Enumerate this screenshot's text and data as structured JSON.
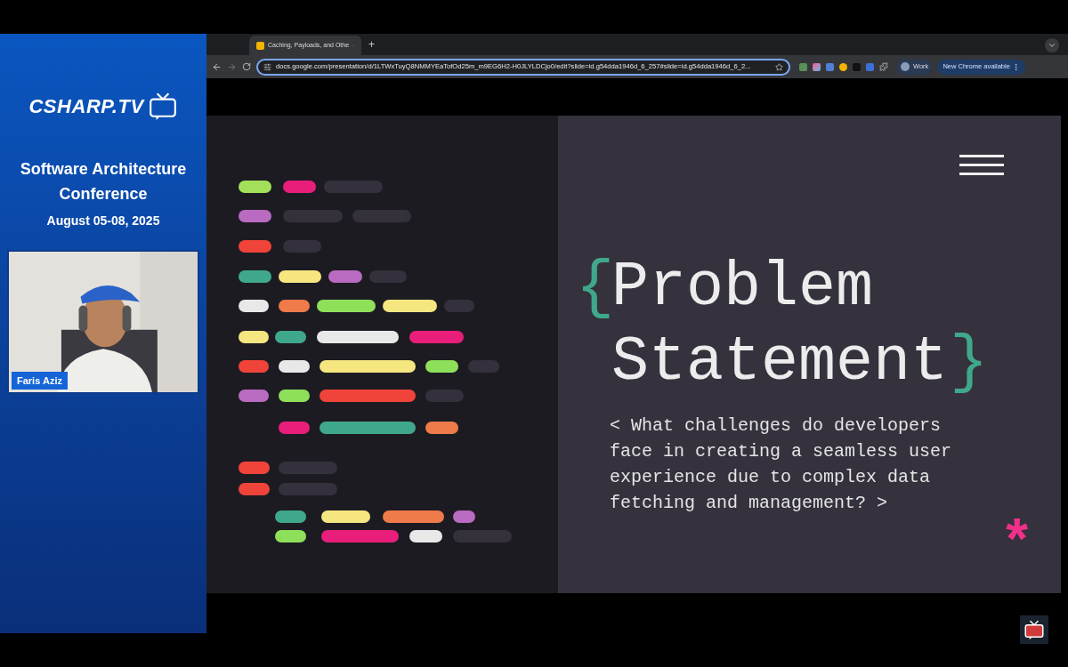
{
  "sidebar": {
    "brand": "CSHARP.TV",
    "event_title": "Software Architecture Conference",
    "event_dates": "August 05-08, 2025",
    "speaker_name": "Faris Aziz"
  },
  "browser": {
    "tab": {
      "title": "Caching, Payloads, and Othe"
    },
    "new_tab": "+",
    "address": "docs.google.com/presentation/d/1LTWxTuyQ8NMMYEaTofOd25m_m9EG6H2-H0JLYLDCjo0/edit?slide=id.g54dda1946d_6_257#slide=id.g54dda1946d_6_2...",
    "profile": "Work",
    "update_button": "New Chrome available"
  },
  "slide": {
    "open_brace": "{",
    "title_line_1": "Problem",
    "title_line_2": "Statement",
    "close_brace": "}",
    "question": "< What challenges do developers face in creating a seamless user experience due to complex data fetching and management? >",
    "asterisk": "*"
  }
}
